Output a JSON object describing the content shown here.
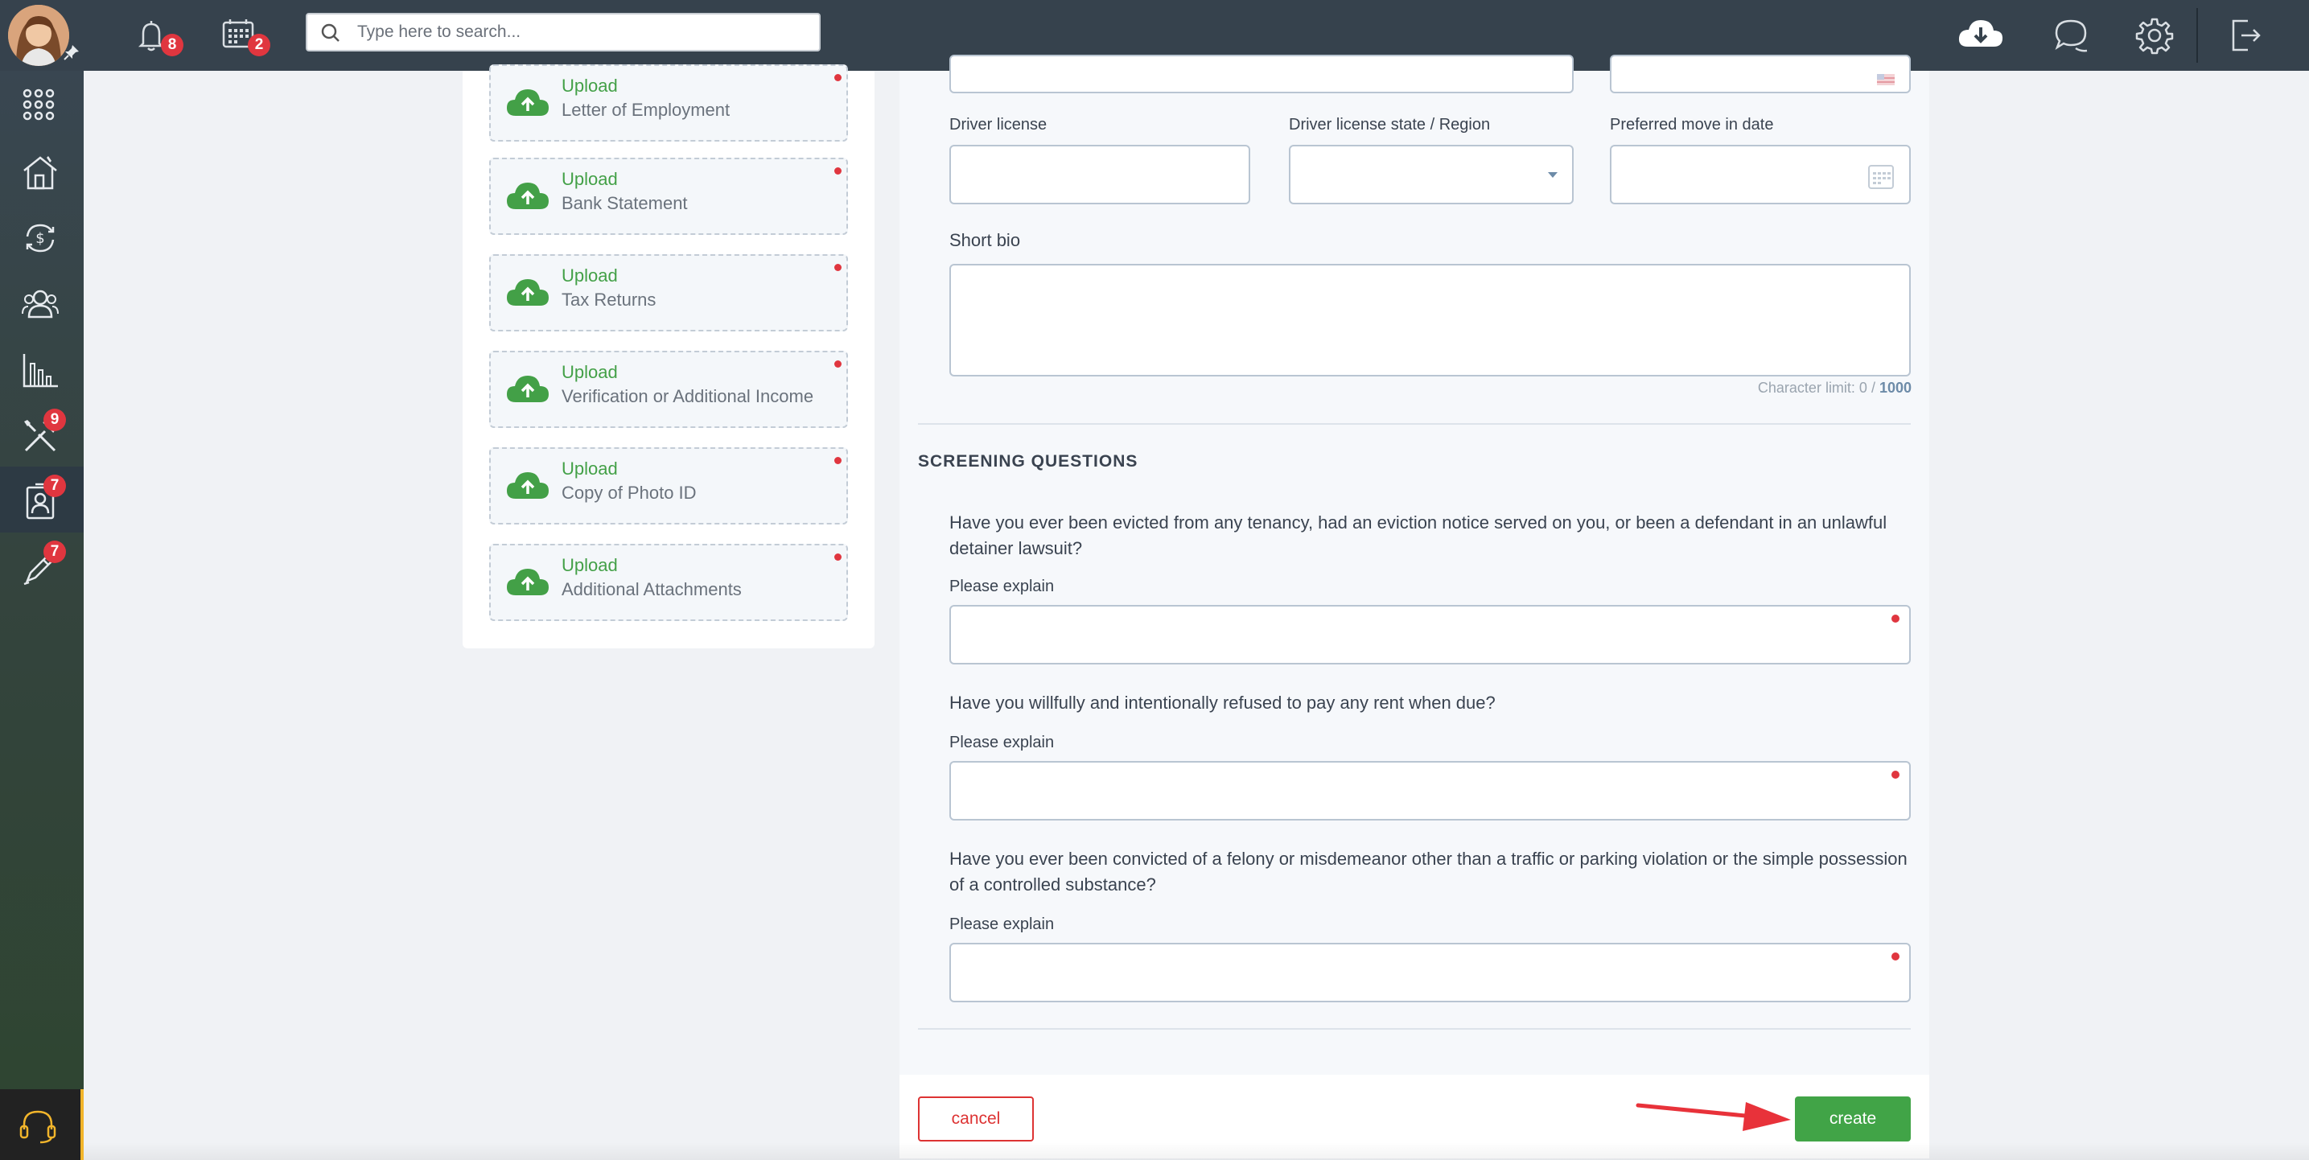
{
  "topbar": {
    "notifications_count": "8",
    "calendar_count": "2",
    "search_placeholder": "Type here to search..."
  },
  "sidebar": {
    "items": [
      {
        "icon": "apps-grid-icon",
        "badge": ""
      },
      {
        "icon": "property-house-icon",
        "badge": ""
      },
      {
        "icon": "accounting-dollar-icon",
        "badge": ""
      },
      {
        "icon": "people-icon",
        "badge": ""
      },
      {
        "icon": "reports-chart-icon",
        "badge": ""
      },
      {
        "icon": "maintenance-tools-icon",
        "badge": "9"
      },
      {
        "icon": "applications-contact-icon",
        "badge": "7"
      },
      {
        "icon": "leasing-pen-icon",
        "badge": "7"
      }
    ]
  },
  "uploads": [
    {
      "action": "Upload",
      "name": "Letter of Employment"
    },
    {
      "action": "Upload",
      "name": "Bank Statement"
    },
    {
      "action": "Upload",
      "name": "Tax Returns"
    },
    {
      "action": "Upload",
      "name": "Verification or Additional Income"
    },
    {
      "action": "Upload",
      "name": "Copy of Photo ID"
    },
    {
      "action": "Upload",
      "name": "Additional Attachments"
    }
  ],
  "form": {
    "driver_license_label": "Driver license",
    "driver_license_state_label": "Driver license state / Region",
    "move_in_label": "Preferred move in date",
    "short_bio_label": "Short bio",
    "char_limit_prefix": "Character limit: 0 / ",
    "char_limit_max": "1000"
  },
  "screening": {
    "title": "SCREENING QUESTIONS",
    "questions": [
      {
        "text": "Have you ever been evicted from any tenancy, had an eviction notice served on you, or been a defendant in an unlawful detainer lawsuit?",
        "explain_label": "Please explain"
      },
      {
        "text": "Have you willfully and intentionally refused to pay any rent when due?",
        "explain_label": "Please explain"
      },
      {
        "text": "Have you ever been convicted of a felony or misdemeanor other than a traffic or parking violation or the simple possession of a controlled substance?",
        "explain_label": "Please explain"
      }
    ]
  },
  "footer": {
    "cancel_label": "cancel",
    "create_label": "create"
  },
  "colors": {
    "topbar": "#36424d",
    "accent_green": "#41a447",
    "danger_red": "#e0363f"
  }
}
